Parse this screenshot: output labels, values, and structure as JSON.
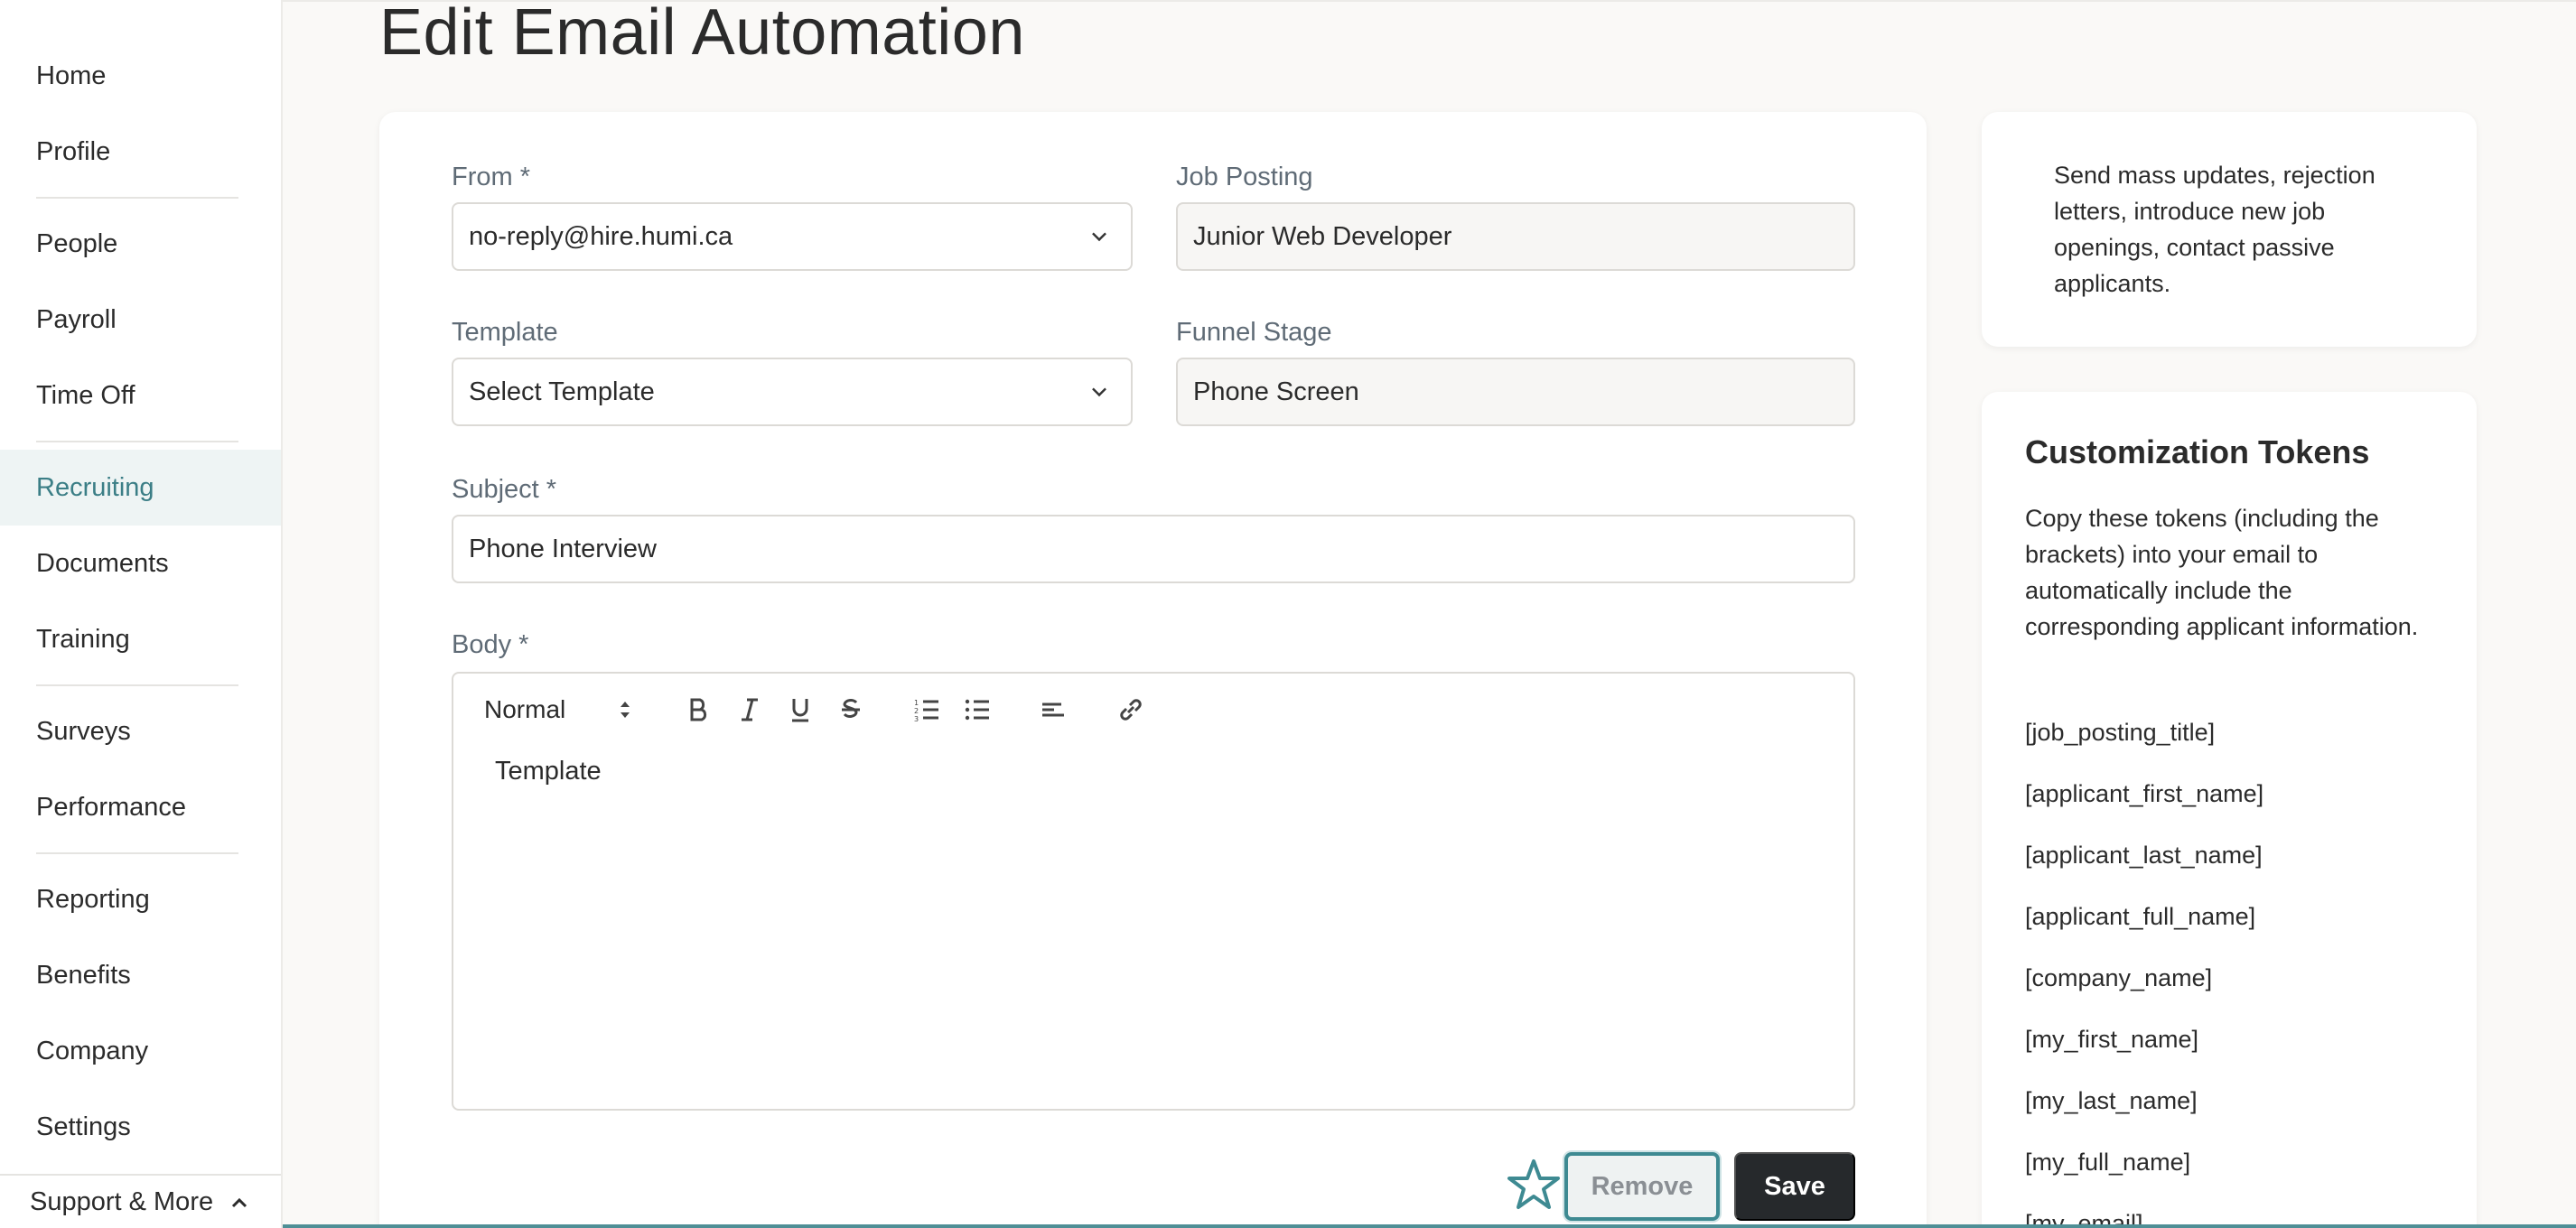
{
  "page": {
    "title": "Edit Email Automation"
  },
  "sidebar": {
    "groups": [
      [
        "Home",
        "Profile"
      ],
      [
        "People",
        "Payroll",
        "Time Off"
      ],
      [
        "Recruiting",
        "Documents",
        "Training"
      ],
      [
        "Surveys",
        "Performance"
      ],
      [
        "Reporting",
        "Benefits",
        "Company",
        "Settings"
      ]
    ],
    "active": "Recruiting",
    "support_label": "Support & More"
  },
  "form": {
    "from": {
      "label": "From *",
      "value": "no-reply@hire.humi.ca"
    },
    "job_posting": {
      "label": "Job Posting",
      "value": "Junior Web Developer"
    },
    "template": {
      "label": "Template",
      "value": "Select Template"
    },
    "funnel_stage": {
      "label": "Funnel Stage",
      "value": "Phone Screen"
    },
    "subject": {
      "label": "Subject *",
      "value": "Phone Interview"
    },
    "body": {
      "label": "Body *",
      "format": "Normal",
      "content": "Template"
    },
    "remove_label": "Remove",
    "save_label": "Save"
  },
  "info": {
    "text": "Send mass updates, rejection letters, introduce new job openings, contact passive applicants."
  },
  "tokens": {
    "title": "Customization Tokens",
    "description": "Copy these tokens (including the brackets) into your email to automatically include the corresponding applicant information.",
    "items": [
      "[job_posting_title]",
      "[applicant_first_name]",
      "[applicant_last_name]",
      "[applicant_full_name]",
      "[company_name]",
      "[my_first_name]",
      "[my_last_name]",
      "[my_full_name]",
      "[my_email]"
    ]
  },
  "colors": {
    "accent": "#3b7e86",
    "active_bg": "#eef4f4",
    "save_bg": "#26292c"
  }
}
